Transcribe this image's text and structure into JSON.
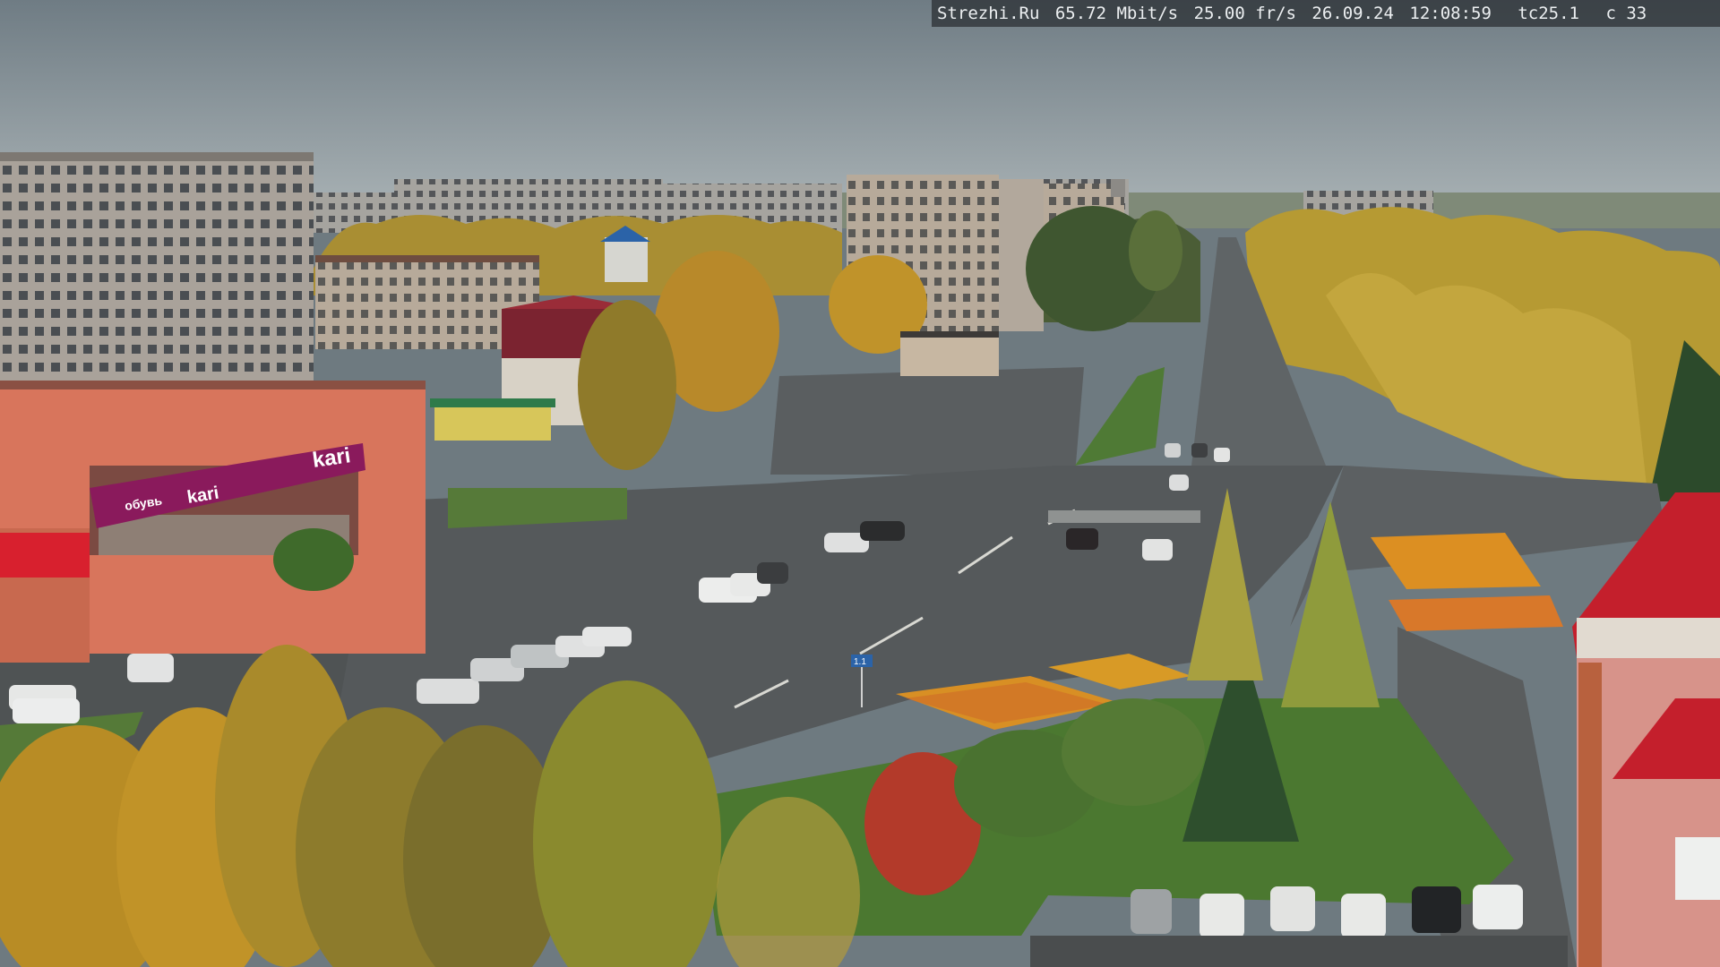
{
  "overlay": {
    "site": "Strezhi.Ru",
    "bitrate": "65.72 Mbit/s",
    "framerate": "25.00 fr/s",
    "date": "26.09.24",
    "time": "12:08:59",
    "tc": "tc25.1",
    "cam": "c 33"
  },
  "store_sign": {
    "brand": "kari",
    "line1": "обувь",
    "line2": "kari"
  },
  "road_sign": "1.1",
  "colors": {
    "sky_top": "#6f7c84",
    "sky_bottom": "#a7b0b4",
    "asphalt": "#55595b",
    "grass": "#4d7a32",
    "autumn_yellow": "#c79a1e",
    "store_magenta": "#8a1a5c",
    "tower_red": "#c41f2c"
  }
}
